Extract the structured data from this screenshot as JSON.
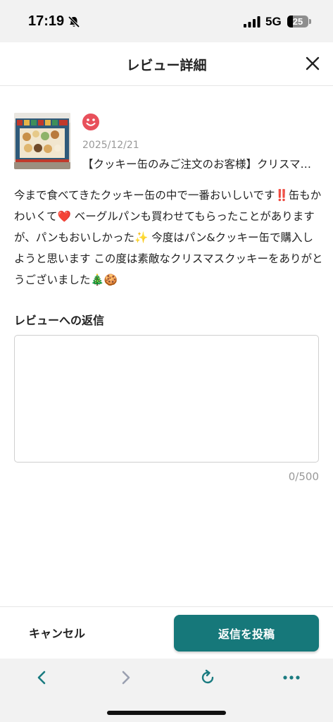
{
  "status_bar": {
    "time": "17:19",
    "network": "5G",
    "battery_level": "25",
    "battery_fraction": 0.25
  },
  "header": {
    "title": "レビュー詳細",
    "close_icon": "close-icon"
  },
  "review": {
    "rating_icon": "smiley-icon",
    "rating_color": "#e8505b",
    "date": "2025/12/21",
    "product_name": "【クッキー缶のみご注文のお客様】クリスマスクッキー缶",
    "body": "今まで食べてきたクッキー缶の中で一番おいしいです‼️缶もかわいくて❤️ ベーグルパンも買わせてもらったことがありますが、パンもおいしかった✨ 今度はパン&クッキー缶で購入しようと思います この度は素敵なクリスマスクッキーをありがとうございました🎄🍪"
  },
  "reply": {
    "label": "レビューへの返信",
    "value": "",
    "counter": "0/500"
  },
  "actions": {
    "cancel_label": "キャンセル",
    "submit_label": "返信を投稿",
    "accent_color": "#16787a"
  },
  "browser_toolbar": {
    "icons": [
      "back-icon",
      "forward-icon",
      "reload-icon",
      "more-icon"
    ]
  }
}
